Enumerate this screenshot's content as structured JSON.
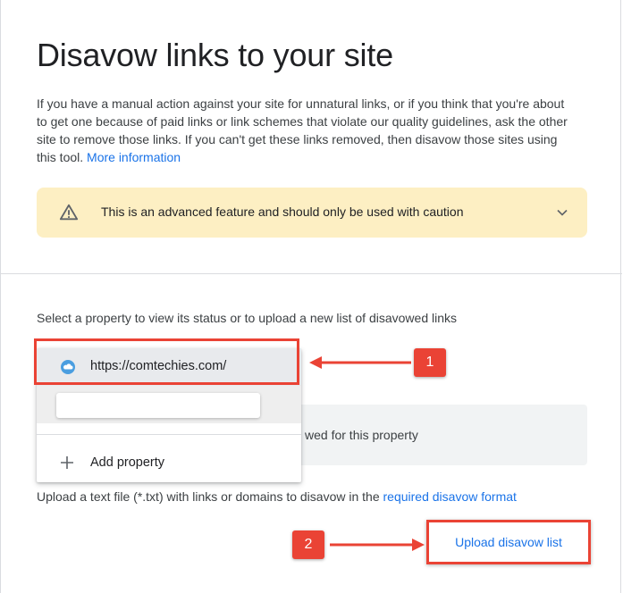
{
  "page": {
    "title": "Disavow links to your site",
    "description": "If you have a manual action against your site for unnatural links, or if you think that you're about to get one because of paid links or link schemes that violate our quality guidelines, ask the other site to remove those links. If you can't get these links removed, then disavow those sites using this tool.",
    "more_info_link": "More information"
  },
  "warning": {
    "text": "This is an advanced feature and should only be used with caution",
    "icon": "warning-triangle-icon",
    "expand_icon": "chevron-down-icon",
    "bg_color": "#fdefc3"
  },
  "property_section": {
    "label": "Select a property to view its status or to upload a new list of disavowed links",
    "status_text_partial": "wed for this property"
  },
  "dropdown": {
    "selected_property": "https://comtechies.com/",
    "search_placeholder": "",
    "add_property": "Add property"
  },
  "upload": {
    "description_prefix": "Upload a text file (*.txt) with links or domains to disavow in the",
    "format_link": "required disavow format",
    "button_label": "Upload disavow list"
  },
  "annotations": {
    "badge1": "1",
    "badge2": "2",
    "color": "#ea4335"
  },
  "colors": {
    "link": "#1a73e8",
    "text": "#202124"
  }
}
